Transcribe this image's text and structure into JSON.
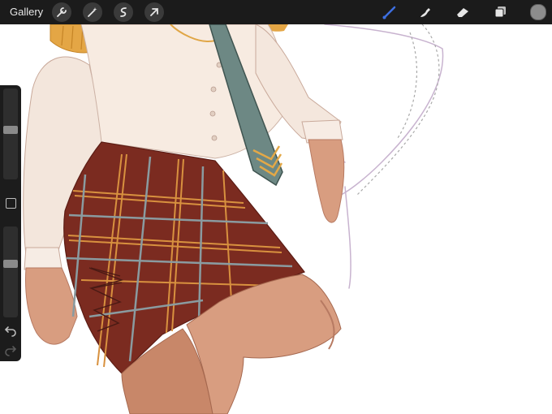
{
  "toolbar": {
    "gallery_label": "Gallery",
    "left_tools": [
      "wrench-icon",
      "magic-wand-icon",
      "selection-icon",
      "transform-arrow-icon"
    ],
    "right_tools": [
      "brush-icon",
      "smudge-icon",
      "eraser-icon",
      "layers-icon",
      "color-swatch"
    ],
    "active_tool": "brush-icon",
    "active_color": "#3d6fe0",
    "current_color": "#8c8c8c"
  },
  "sidebar": {
    "brush_size": 0.55,
    "opacity": 0.6,
    "tools": [
      "brush-size-slider",
      "modify-button",
      "opacity-slider",
      "undo-icon",
      "redo-icon"
    ]
  },
  "canvas": {
    "subject": "illustration-of-plaid-skirt-and-tie",
    "palette": {
      "shirt": "#f6e9dd",
      "skirt": "#7a2a1f",
      "plaid_gold": "#d8913f",
      "plaid_grey": "#7f9094",
      "tie": "#6f8a86",
      "tie_stripe": "#e0a646",
      "skin": "#d79a7d",
      "epaulette": "#e7ad4a"
    }
  }
}
